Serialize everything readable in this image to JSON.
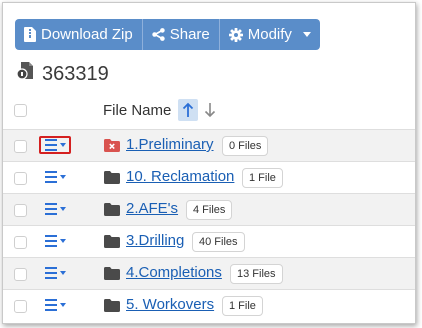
{
  "toolbar": {
    "download_label": "Download Zip",
    "share_label": "Share",
    "modify_label": "Modify",
    "button_color": "#5a8dc9"
  },
  "page": {
    "title": "363319"
  },
  "table": {
    "column_header": "File Name",
    "sort": "ascending",
    "rows": [
      {
        "name": "1.Preliminary",
        "count": "0 Files",
        "folder_icon": "folder-x-icon",
        "folder_color": "#d9534f"
      },
      {
        "name": "10. Reclamation",
        "count": "1 File",
        "folder_icon": "folder-icon",
        "folder_color": "#4a4a4a"
      },
      {
        "name": "2.AFE's",
        "count": "4 Files",
        "folder_icon": "folder-icon",
        "folder_color": "#4a4a4a"
      },
      {
        "name": "3.Drilling",
        "count": "40 Files",
        "folder_icon": "folder-icon",
        "folder_color": "#4a4a4a"
      },
      {
        "name": "4.Completions",
        "count": "13 Files",
        "folder_icon": "folder-icon",
        "folder_color": "#4a4a4a"
      },
      {
        "name": "5. Workovers",
        "count": "1 File",
        "folder_icon": "folder-icon",
        "folder_color": "#4a4a4a"
      }
    ]
  }
}
